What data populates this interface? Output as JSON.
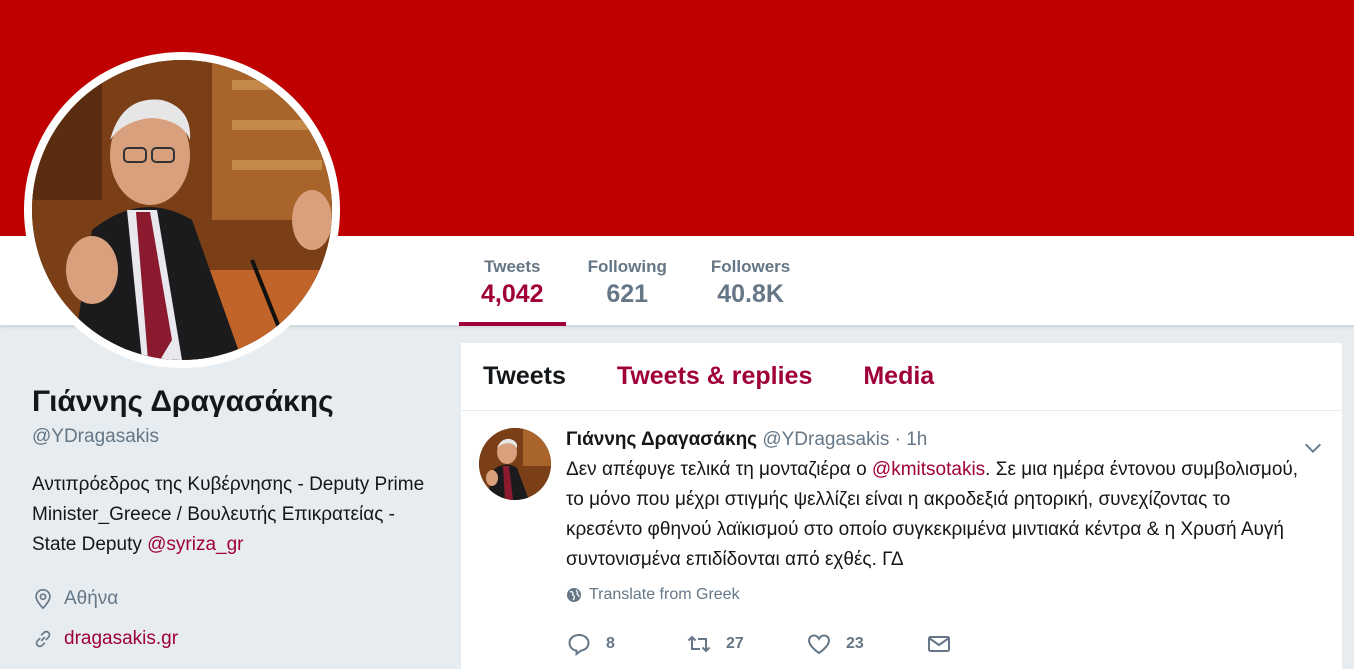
{
  "colors": {
    "brand": "#a0003a",
    "banner": "#c00000",
    "muted": "#657786",
    "text": "#14171a"
  },
  "stats": [
    {
      "label": "Tweets",
      "value": "4,042"
    },
    {
      "label": "Following",
      "value": "621"
    },
    {
      "label": "Followers",
      "value": "40.8K"
    }
  ],
  "profile": {
    "name": "Γιάννης Δραγασάκης",
    "handle": "@YDragasakis",
    "bio_text": "Αντιπρόεδρος της Κυβέρνησης - Deputy Prime Minister_Greece / Βουλευτής Επικρατείας - State Deputy ",
    "bio_link": "@syriza_gr",
    "location": "Αθήνα",
    "location_icon": "location-pin-icon",
    "url": "dragasakis.gr",
    "url_icon": "link-icon"
  },
  "tabs": [
    {
      "label": "Tweets"
    },
    {
      "label": "Tweets & replies"
    },
    {
      "label": "Media"
    }
  ],
  "tweet": {
    "name": "Γιάννης Δραγασάκης",
    "handle": "@YDragasakis",
    "separator": "·",
    "time": "1h",
    "text_before": "Δεν απέφυγε τελικά τη μονταζιέρα ο ",
    "mention": "@kmitsotakis",
    "text_after": ". Σε μια ημέρα έντονου συμβολισμού, το μόνο που μέχρι στιγμής ψελλίζει είναι η ακροδεξιά ρητορική, συνεχίζοντας το κρεσέντο φθηνού λαϊκισμού στο οποίο συγκεκριμένα μιντιακά κέντρα & η Χρυσή Αυγή συντονισμένα επιδίδονται από εχθές. ΓΔ",
    "translate_label": "Translate from Greek",
    "replies": "8",
    "retweets": "27",
    "likes": "23"
  }
}
